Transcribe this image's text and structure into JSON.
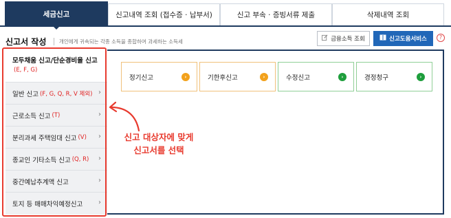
{
  "tabs": [
    {
      "label": "세금신고",
      "active": true
    },
    {
      "label": "신고내역 조회 (접수증 · 납부서)",
      "active": false
    },
    {
      "label": "신고 부속 · 증빙서류 제출",
      "active": false
    },
    {
      "label": "삭제내역 조회",
      "active": false
    }
  ],
  "header": {
    "title": "신고서 작성",
    "description": "개인에게 귀속되는 각종 소득을 종합하여 과세하는 소득세",
    "finance_button": "금융소득 조회",
    "help_button": "신고도움서비스",
    "help_q": "?"
  },
  "left_menu": [
    {
      "label": "모두채움 신고/단순경비율 신고",
      "tag": "(E, F, G)",
      "selected": true
    },
    {
      "label": "일반 신고",
      "tag": "(F, G, Q, R, V 제외)",
      "selected": false
    },
    {
      "label": "근로소득 신고",
      "tag": "(T)",
      "selected": false
    },
    {
      "label": "분리과세 주택임대 신고",
      "tag": "(V)",
      "selected": false
    },
    {
      "label": "종교인 기타소득 신고",
      "tag": "(Q, R)",
      "selected": false
    },
    {
      "label": "중간예납추계액 신고",
      "tag": "",
      "selected": false
    },
    {
      "label": "토지 등 매매차익예정신고",
      "tag": "",
      "selected": false
    }
  ],
  "options": [
    {
      "label": "정기신고",
      "color": "#f2a11c"
    },
    {
      "label": "기한후신고",
      "color": "#f2a11c"
    },
    {
      "label": "수정신고",
      "color": "#1e9e3c"
    },
    {
      "label": "경정청구",
      "color": "#1e9e3c"
    }
  ],
  "annotation": {
    "line1": "신고 대상자에 맞게",
    "line2": "신고서를 선택"
  },
  "colors": {
    "primary": "#1e3a5f",
    "accent_blue": "#2167b8",
    "highlight_red": "#e83a2e"
  }
}
